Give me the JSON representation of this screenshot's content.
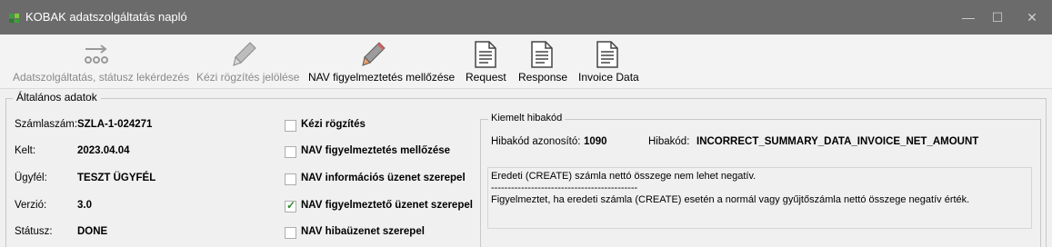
{
  "window": {
    "title": "KOBAK adatszolgáltatás napló",
    "min_glyph": "—",
    "max_glyph": "☐",
    "close_glyph": "✕"
  },
  "toolbar": {
    "items": [
      {
        "label": "Adatszolgáltatás, státusz lekérdezés",
        "icon": "arrow-chain-icon",
        "enabled": false
      },
      {
        "label": "Kézi rögzítés jelölése",
        "icon": "pencil-icon",
        "enabled": false
      },
      {
        "label": "NAV figyelmeztetés mellőzése",
        "icon": "pencil-icon",
        "enabled": true
      },
      {
        "label": "Request",
        "icon": "document-icon",
        "enabled": true
      },
      {
        "label": "Response",
        "icon": "document-icon",
        "enabled": true
      },
      {
        "label": "Invoice Data",
        "icon": "document-icon",
        "enabled": true
      }
    ]
  },
  "general": {
    "title": "Általános adatok",
    "fields": [
      {
        "label": "Számlaszám:",
        "value": "SZLA-1-024271"
      },
      {
        "label": "Kelt:",
        "value": "2023.04.04"
      },
      {
        "label": "Ügyfél:",
        "value": "TESZT ÜGYFÉL"
      },
      {
        "label": "Verzió:",
        "value": "3.0"
      },
      {
        "label": "Státusz:",
        "value": "DONE"
      }
    ],
    "checkboxes": [
      {
        "label": "Kézi rögzítés",
        "checked": false
      },
      {
        "label": "NAV figyelmeztetés mellőzése",
        "checked": false
      },
      {
        "label": "NAV információs üzenet szerepel",
        "checked": false
      },
      {
        "label": "NAV figyelmeztető üzenet szerepel",
        "checked": true
      },
      {
        "label": "NAV hibaüzenet szerepel",
        "checked": false
      }
    ],
    "check_glyph": "✓"
  },
  "error": {
    "title": "Kiemelt hibakód",
    "id_label": "Hibakód azonosító:",
    "id_value": "1090",
    "code_label": "Hibakód:",
    "code_value": "INCORRECT_SUMMARY_DATA_INVOICE_NET_AMOUNT",
    "text_lines": [
      "Eredeti (CREATE) számla nettó összege nem lehet negatív.",
      "--------------------------------------------",
      "Figyelmeztet, ha eredeti számla (CREATE) esetén a normál vagy gyűjtőszámla nettó összege negatív érték."
    ]
  },
  "colors": {
    "titlebar": "#6b6b6b",
    "app_icon": "#3aa13a",
    "check": "#2a8a2a",
    "disabled_text": "#8a8a8a"
  }
}
